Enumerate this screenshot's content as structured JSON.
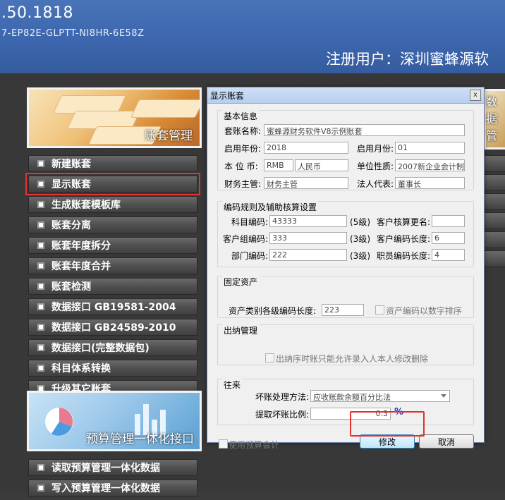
{
  "header": {
    "version": ".50.1818",
    "serial": "7-EP82E-GLPTT-NI8HR-6E58Z",
    "registered_user": "注册用户：深圳蜜蜂源软"
  },
  "left_panel": {
    "hero_caption": "账套管理",
    "menu_items": [
      {
        "label": "新建账套"
      },
      {
        "label": "显示账套"
      },
      {
        "label": "生成账套模板库"
      },
      {
        "label": "账套分离"
      },
      {
        "label": "账套年度拆分"
      },
      {
        "label": "账套年度合并"
      },
      {
        "label": "账套检测"
      },
      {
        "label": "数据接口 GB19581-2004"
      },
      {
        "label": "数据接口 GB24589-2010"
      },
      {
        "label": "数据接口(完整数据包)"
      },
      {
        "label": "科目体系转换"
      },
      {
        "label": "升级其它账套"
      }
    ],
    "hero2_caption": "预算管理一体化接口",
    "bottom_items": [
      {
        "label": "读取预算管理一体化数据"
      },
      {
        "label": "写入预算管理一体化数据"
      }
    ]
  },
  "right_strip": {
    "hero_caption": "数据管"
  },
  "dialog": {
    "title": "显示账套",
    "close_glyph": "x",
    "basic": {
      "group_title": "基本信息",
      "account_name_label": "套账名称:",
      "account_name": "蜜蜂源财务软件V8示例账套",
      "start_year_label": "启用年份:",
      "start_year": "2018",
      "start_month_label": "启用月份:",
      "start_month": "01",
      "currency_label": "本 位 币:",
      "currency_code": "RMB",
      "currency_name": "人民币",
      "unit_type_label": "单位性质:",
      "unit_type": "2007新企业会计制",
      "finance_head_label": "财务主管:",
      "finance_head": "财务主管",
      "legal_rep_label": "法人代表:",
      "legal_rep": "董事长"
    },
    "coding": {
      "group_title": "编码规则及辅助核算设置",
      "subject_code_label": "科目编码:",
      "subject_code": "43333",
      "subject_levels": "(5级)",
      "customer_rename_label": "客户核算更名:",
      "customer_rename": "",
      "customer_group_label": "客户组编码:",
      "customer_group": "333",
      "customer_group_levels": "(3级)",
      "customer_code_len_label": "客户编码长度:",
      "customer_code_len": "6",
      "dept_code_label": "部门编码:",
      "dept_code": "222",
      "dept_levels": "(3级)",
      "staff_code_len_label": "职员编码长度:",
      "staff_code_len": "4"
    },
    "fixed_assets": {
      "group_title": "固定资产",
      "asset_class_len_label": "资产类别各级编码长度:",
      "asset_class_len": "223",
      "sort_numeric_label": "资产编码以数字排序"
    },
    "cashier": {
      "group_title": "出纳管理",
      "cashier_option_label": "出纳序时账只能允许录入人本人修改删除"
    },
    "dealings": {
      "group_title": "往来",
      "bad_debt_method_label": "坏账处理方法:",
      "bad_debt_method": "应收账款余额百分比法",
      "bad_debt_ratio_label": "提取坏账比例:",
      "bad_debt_ratio": "0.3",
      "percent_sign": "%"
    },
    "use_budget_label": "使用预算会计",
    "modify_button": "修改",
    "cancel_button": "取消"
  },
  "colors": {
    "header_blue": "#3c66ad",
    "highlight_red": "#e53030",
    "percent_blue": "#1c3fbf"
  }
}
